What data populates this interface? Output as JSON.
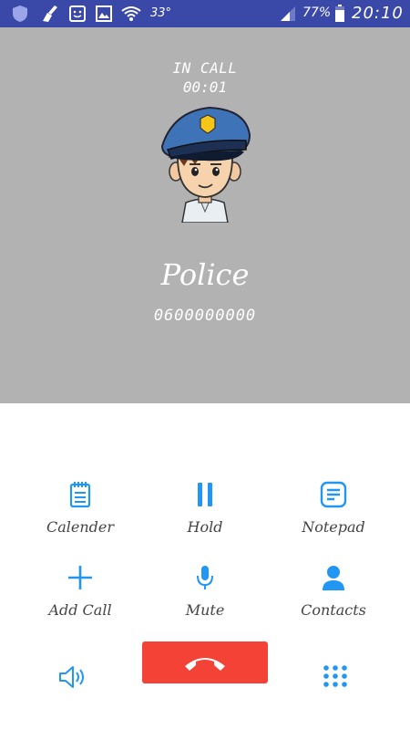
{
  "status_bar": {
    "temperature": "33°",
    "battery": "77%",
    "time": "20:10",
    "icons": [
      "shield-icon",
      "broom-icon",
      "sim-icon",
      "image-icon",
      "wifi-icon",
      "signal-icon",
      "battery-icon"
    ]
  },
  "call": {
    "state": "IN CALL",
    "timer": "00:01",
    "contact_name": "Police",
    "contact_number": "0600000000",
    "avatar": "police-officer-avatar"
  },
  "actions": [
    {
      "label": "Calender",
      "icon": "calendar-icon"
    },
    {
      "label": "Hold",
      "icon": "pause-icon"
    },
    {
      "label": "Notepad",
      "icon": "notepad-icon"
    },
    {
      "label": "Add Call",
      "icon": "plus-icon"
    },
    {
      "label": "Mute",
      "icon": "microphone-icon"
    },
    {
      "label": "Contacts",
      "icon": "person-icon"
    }
  ],
  "bottom": {
    "speaker_icon": "speaker-icon",
    "hangup_icon": "hangup-icon",
    "dialpad_icon": "dialpad-icon"
  },
  "colors": {
    "status_bar": "#3a48a8",
    "call_panel": "#b2b2b2",
    "accent": "#2196f3",
    "hangup": "#f44336"
  }
}
